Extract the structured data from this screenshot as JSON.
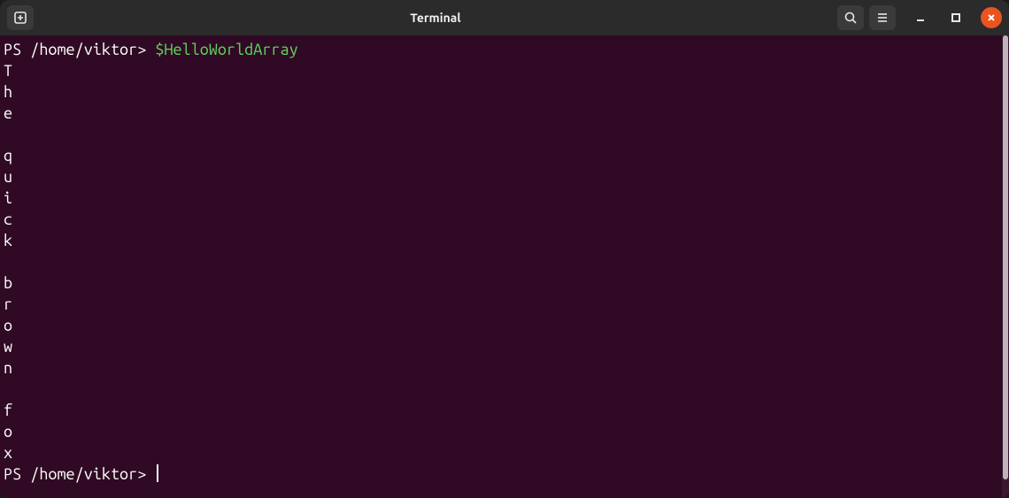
{
  "titlebar": {
    "title": "Terminal",
    "new_tab_icon": "new-tab-icon",
    "search_icon": "search-icon",
    "menu_icon": "hamburger-icon",
    "minimize_icon": "minimize-icon",
    "maximize_icon": "maximize-icon",
    "close_icon": "close-icon"
  },
  "terminal": {
    "line1_prompt": "PS /home/viktor>",
    "line1_cmd": "$HelloWorldArray",
    "output": [
      "T",
      "h",
      "e",
      "",
      "q",
      "u",
      "i",
      "c",
      "k",
      "",
      "b",
      "r",
      "o",
      "w",
      "n",
      "",
      "f",
      "o",
      "x"
    ],
    "line2_prompt": "PS /home/viktor>"
  }
}
